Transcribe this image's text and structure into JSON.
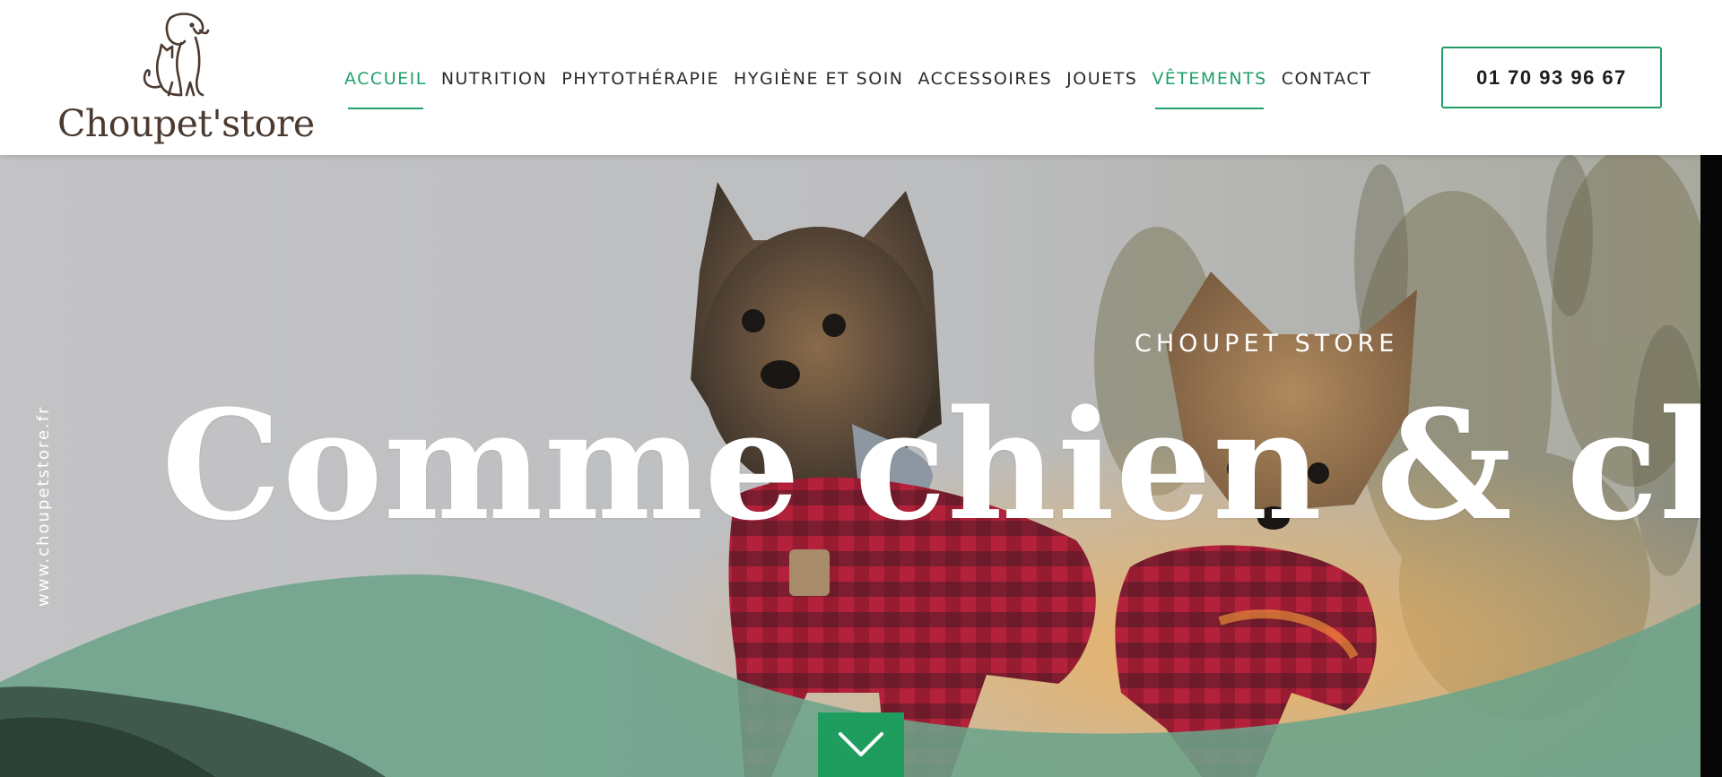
{
  "brand": {
    "name": "Choupet'store"
  },
  "nav": {
    "items": [
      {
        "label": "ACCUEIL",
        "active": true
      },
      {
        "label": "NUTRITION",
        "active": false
      },
      {
        "label": "PHYTOTHÉRAPIE",
        "active": false
      },
      {
        "label": "HYGIÈNE ET SOIN",
        "active": false
      },
      {
        "label": "ACCESSOIRES",
        "active": false
      },
      {
        "label": "JOUETS",
        "active": false
      },
      {
        "label": "VÊTEMENTS",
        "active": true
      },
      {
        "label": "CONTACT",
        "active": false
      }
    ]
  },
  "header": {
    "phone": "01 70 93 96 67"
  },
  "hero": {
    "side_url": "www.choupetstore.fr",
    "kicker": "CHOUPET STORE",
    "title": "Comme chien & chat !",
    "scroll_icon": "chevron-down-icon"
  },
  "colors": {
    "accent": "#20a06a",
    "wave": "#6ca38a",
    "logo": "#4a3a30",
    "hero_sky": "#bfc0c2"
  }
}
